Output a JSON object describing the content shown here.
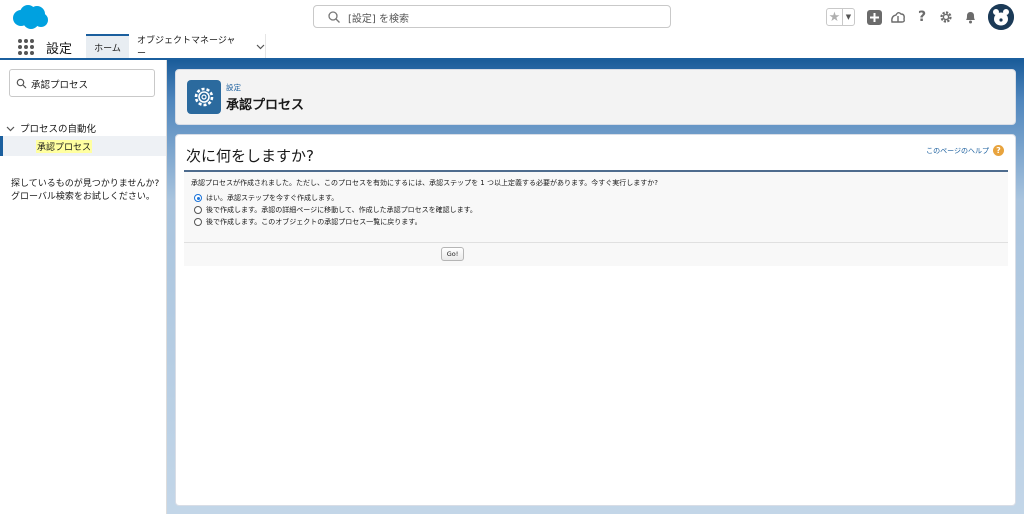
{
  "colors": {
    "brand_blue": "#00a1e0",
    "nav_accent": "#1b5f9e",
    "icon_tile": "#2b6a9e",
    "highlight": "#ffffa0",
    "help_orange": "#e8a33d"
  },
  "header": {
    "logo_icon": "salesforce-cloud-logo",
    "search_placeholder": "[設定] を検索",
    "icons": [
      "favorites-star-icon",
      "favorites-dropdown-icon",
      "global-actions-plus-icon",
      "trailhead-icon",
      "help-question-icon",
      "setup-gear-icon",
      "notifications-bell-icon",
      "user-avatar"
    ]
  },
  "app_nav": {
    "app_name": "設定",
    "tabs": [
      {
        "label": "ホーム",
        "active": true
      },
      {
        "label": "オブジェクトマネージャー",
        "has_dropdown": true
      }
    ]
  },
  "sidebar": {
    "quickfind_value": "承認プロセス",
    "tree": {
      "parent_label": "プロセスの自動化",
      "child_label": "承認プロセス"
    },
    "not_found_text": "探しているものが見つかりませんか? グローバル検索をお試しください。"
  },
  "page_header": {
    "subtitle": "設定",
    "title": "承認プロセス",
    "icon": "setup-gear-icon"
  },
  "content": {
    "title": "次に何をしますか?",
    "help_link": "このページのヘルプ",
    "message": "承認プロセスが作成されました。ただし、このプロセスを有効にするには、承認ステップを 1 つ以上定義する必要があります。今すぐ実行しますか?",
    "options": [
      {
        "label": "はい。承認ステップを今すぐ作成します。",
        "selected": true
      },
      {
        "label": "後で作成します。承認の詳細ページに移動して、作成した承認プロセスを確認します。",
        "selected": false
      },
      {
        "label": "後で作成します。このオブジェクトの承認プロセス一覧に戻ります。",
        "selected": false
      }
    ],
    "go_button": "Go!"
  }
}
